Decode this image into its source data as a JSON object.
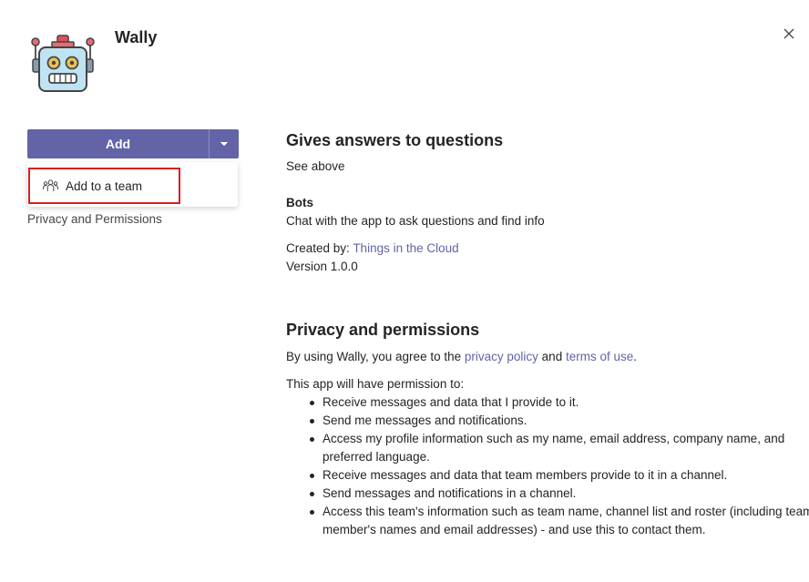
{
  "app": {
    "name": "Wally",
    "icon": "robot-icon"
  },
  "actions": {
    "add_label": "Add",
    "dropdown_icon": "chevron-down-icon",
    "menu_items": [
      {
        "label": "Add to a team",
        "icon": "team-icon"
      }
    ]
  },
  "sidebar": {
    "privacy_link": "Privacy and Permissions"
  },
  "details": {
    "heading": "Gives answers to questions",
    "description": "See above",
    "capability_title": "Bots",
    "capability_desc": "Chat with the app to ask questions and find info",
    "created_by_label": "Created by:",
    "created_by_value": "Things in the Cloud",
    "version": "Version 1.0.0"
  },
  "privacy": {
    "heading": "Privacy and permissions",
    "intro_prefix": "By using Wally, you agree to the",
    "privacy_policy_link": "privacy policy",
    "and_text": "and",
    "terms_link": "terms of use",
    "period": ".",
    "permission_intro": "This app will have permission to:",
    "permissions": [
      "Receive messages and data that I provide to it.",
      "Send me messages and notifications.",
      "Access my profile information such as my name, email address, company name, and preferred language.",
      "Receive messages and data that team members provide to it in a channel.",
      "Send messages and notifications in a channel.",
      "Access this team's information such as team name, channel list and roster (including team member's names and email addresses) - and use this to contact them."
    ]
  },
  "colors": {
    "accent": "#6264a7",
    "highlight_border": "#d62020",
    "text": "#252423"
  }
}
